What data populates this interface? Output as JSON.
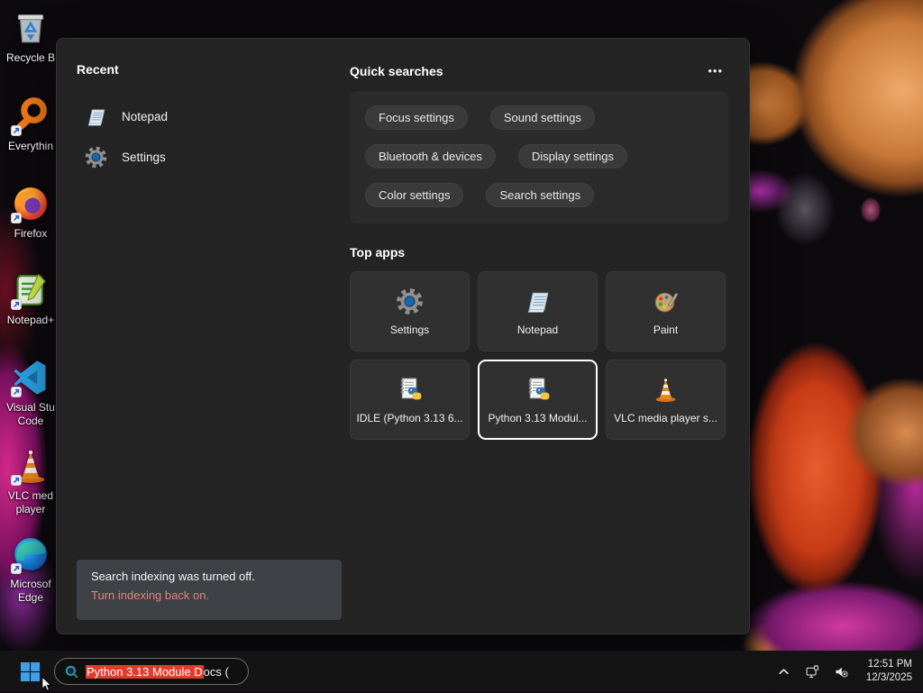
{
  "desktop": {
    "icons": [
      {
        "label": "Recycle B"
      },
      {
        "label": "Everythin"
      },
      {
        "label": "Firefox"
      },
      {
        "label": "Notepad+"
      },
      {
        "label": "Visual Stu\nCode"
      },
      {
        "label": "VLC med\nplayer"
      },
      {
        "label": "Microsof\nEdge"
      }
    ]
  },
  "search_panel": {
    "recent": {
      "title": "Recent",
      "items": [
        {
          "label": "Notepad"
        },
        {
          "label": "Settings"
        }
      ]
    },
    "quick_searches": {
      "title": "Quick searches",
      "more_label": "•••",
      "pills": [
        "Focus settings",
        "Sound settings",
        "Bluetooth & devices",
        "Display settings",
        "Color settings",
        "Search settings"
      ]
    },
    "top_apps": {
      "title": "Top apps",
      "tiles": [
        {
          "label": "Settings",
          "selected": false
        },
        {
          "label": "Notepad",
          "selected": false
        },
        {
          "label": "Paint",
          "selected": false
        },
        {
          "label": "IDLE (Python 3.13 6...",
          "selected": false
        },
        {
          "label": "Python 3.13 Modul...",
          "selected": true
        },
        {
          "label": "VLC media player s...",
          "selected": false
        }
      ]
    },
    "indexing_notice": {
      "message": "Search indexing was turned off.",
      "link": "Turn indexing back on."
    }
  },
  "taskbar": {
    "search": {
      "value_selected": "Python 3.13 Module D",
      "value_rest": "ocs ("
    },
    "tray": {
      "time": "12:51 PM",
      "date": "12/3/2025"
    }
  },
  "colors": {
    "selection_red": "#e13b2a",
    "notice_link": "#e5837a",
    "windows_blue": "#3fa0e8"
  }
}
